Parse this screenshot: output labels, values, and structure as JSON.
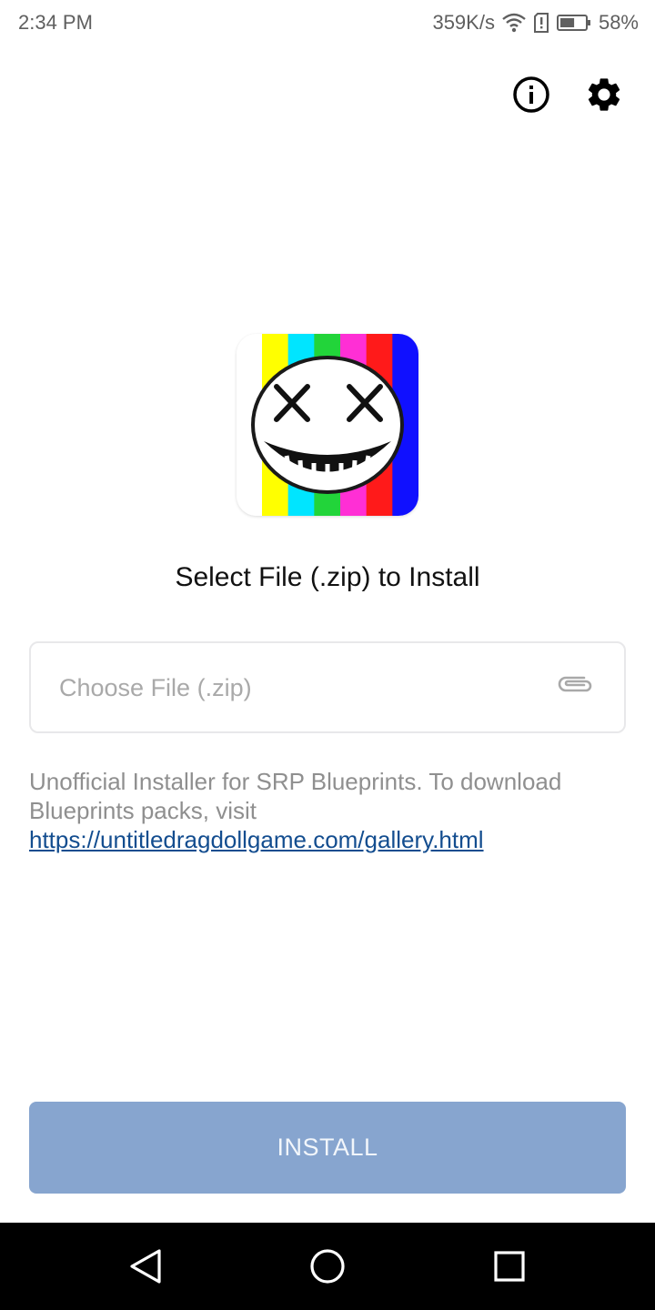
{
  "status_bar": {
    "time": "2:34 PM",
    "network_speed": "359K/s",
    "battery_percent": "58%",
    "battery_level": 0.58,
    "icons": [
      "wifi-icon",
      "sim-alert-icon",
      "battery-icon"
    ]
  },
  "header": {
    "icons": [
      "info-icon",
      "settings-gear-icon"
    ]
  },
  "app_icon": {
    "name": "app-logo",
    "stripe_colors": [
      "#ffffff",
      "#ffff00",
      "#00e5ff",
      "#22d43a",
      "#ff2fd5",
      "#ff1a1a",
      "#1010ff"
    ]
  },
  "main": {
    "title": "Select File (.zip) to Install",
    "file_field_placeholder": "Choose File (.zip)",
    "info_text": "Unofficial Installer for SRP Blueprints. To download Blueprints packs, visit ",
    "info_link": "https://untitledragdollgame.com/gallery.html"
  },
  "install_button": {
    "label": "INSTALL",
    "color": "#87a5cf"
  },
  "nav_bar": {
    "icons": [
      "back-icon",
      "home-icon",
      "recents-icon"
    ]
  },
  "colors": {
    "link": "#134d8f",
    "muted_text": "#8f8f8f"
  }
}
